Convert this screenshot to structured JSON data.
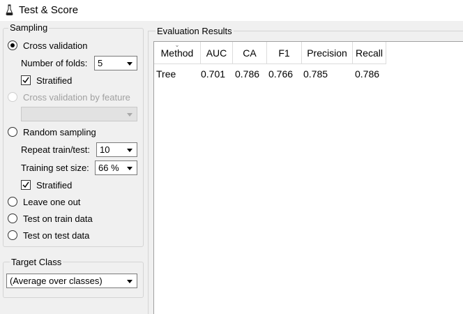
{
  "window": {
    "title": "Test & Score",
    "icon": "flask-icon"
  },
  "sampling": {
    "group_title": "Sampling",
    "cross_validation": {
      "label": "Cross validation",
      "checked": true
    },
    "number_of_folds": {
      "label": "Number of folds:",
      "value": "5"
    },
    "stratified_1": {
      "label": "Stratified",
      "checked": true
    },
    "cv_by_feature": {
      "label": "Cross validation by feature",
      "disabled": true,
      "value": ""
    },
    "random_sampling": {
      "label": "Random sampling",
      "checked": false
    },
    "repeat_train_test": {
      "label": "Repeat train/test:",
      "value": "10"
    },
    "training_set_size": {
      "label": "Training set size:",
      "value": "66 %"
    },
    "stratified_2": {
      "label": "Stratified",
      "checked": true
    },
    "leave_one_out": {
      "label": "Leave one out",
      "checked": false
    },
    "test_on_train": {
      "label": "Test on train data",
      "checked": false
    },
    "test_on_test": {
      "label": "Test on test data",
      "checked": false
    }
  },
  "target_class": {
    "group_title": "Target Class",
    "value": "(Average over classes)"
  },
  "results": {
    "group_title": "Evaluation Results",
    "columns": [
      "Method",
      "AUC",
      "CA",
      "F1",
      "Precision",
      "Recall"
    ],
    "rows": [
      {
        "method": "Tree",
        "auc": "0.701",
        "ca": "0.786",
        "f1": "0.766",
        "precision": "0.785",
        "recall": "0.786"
      }
    ]
  }
}
